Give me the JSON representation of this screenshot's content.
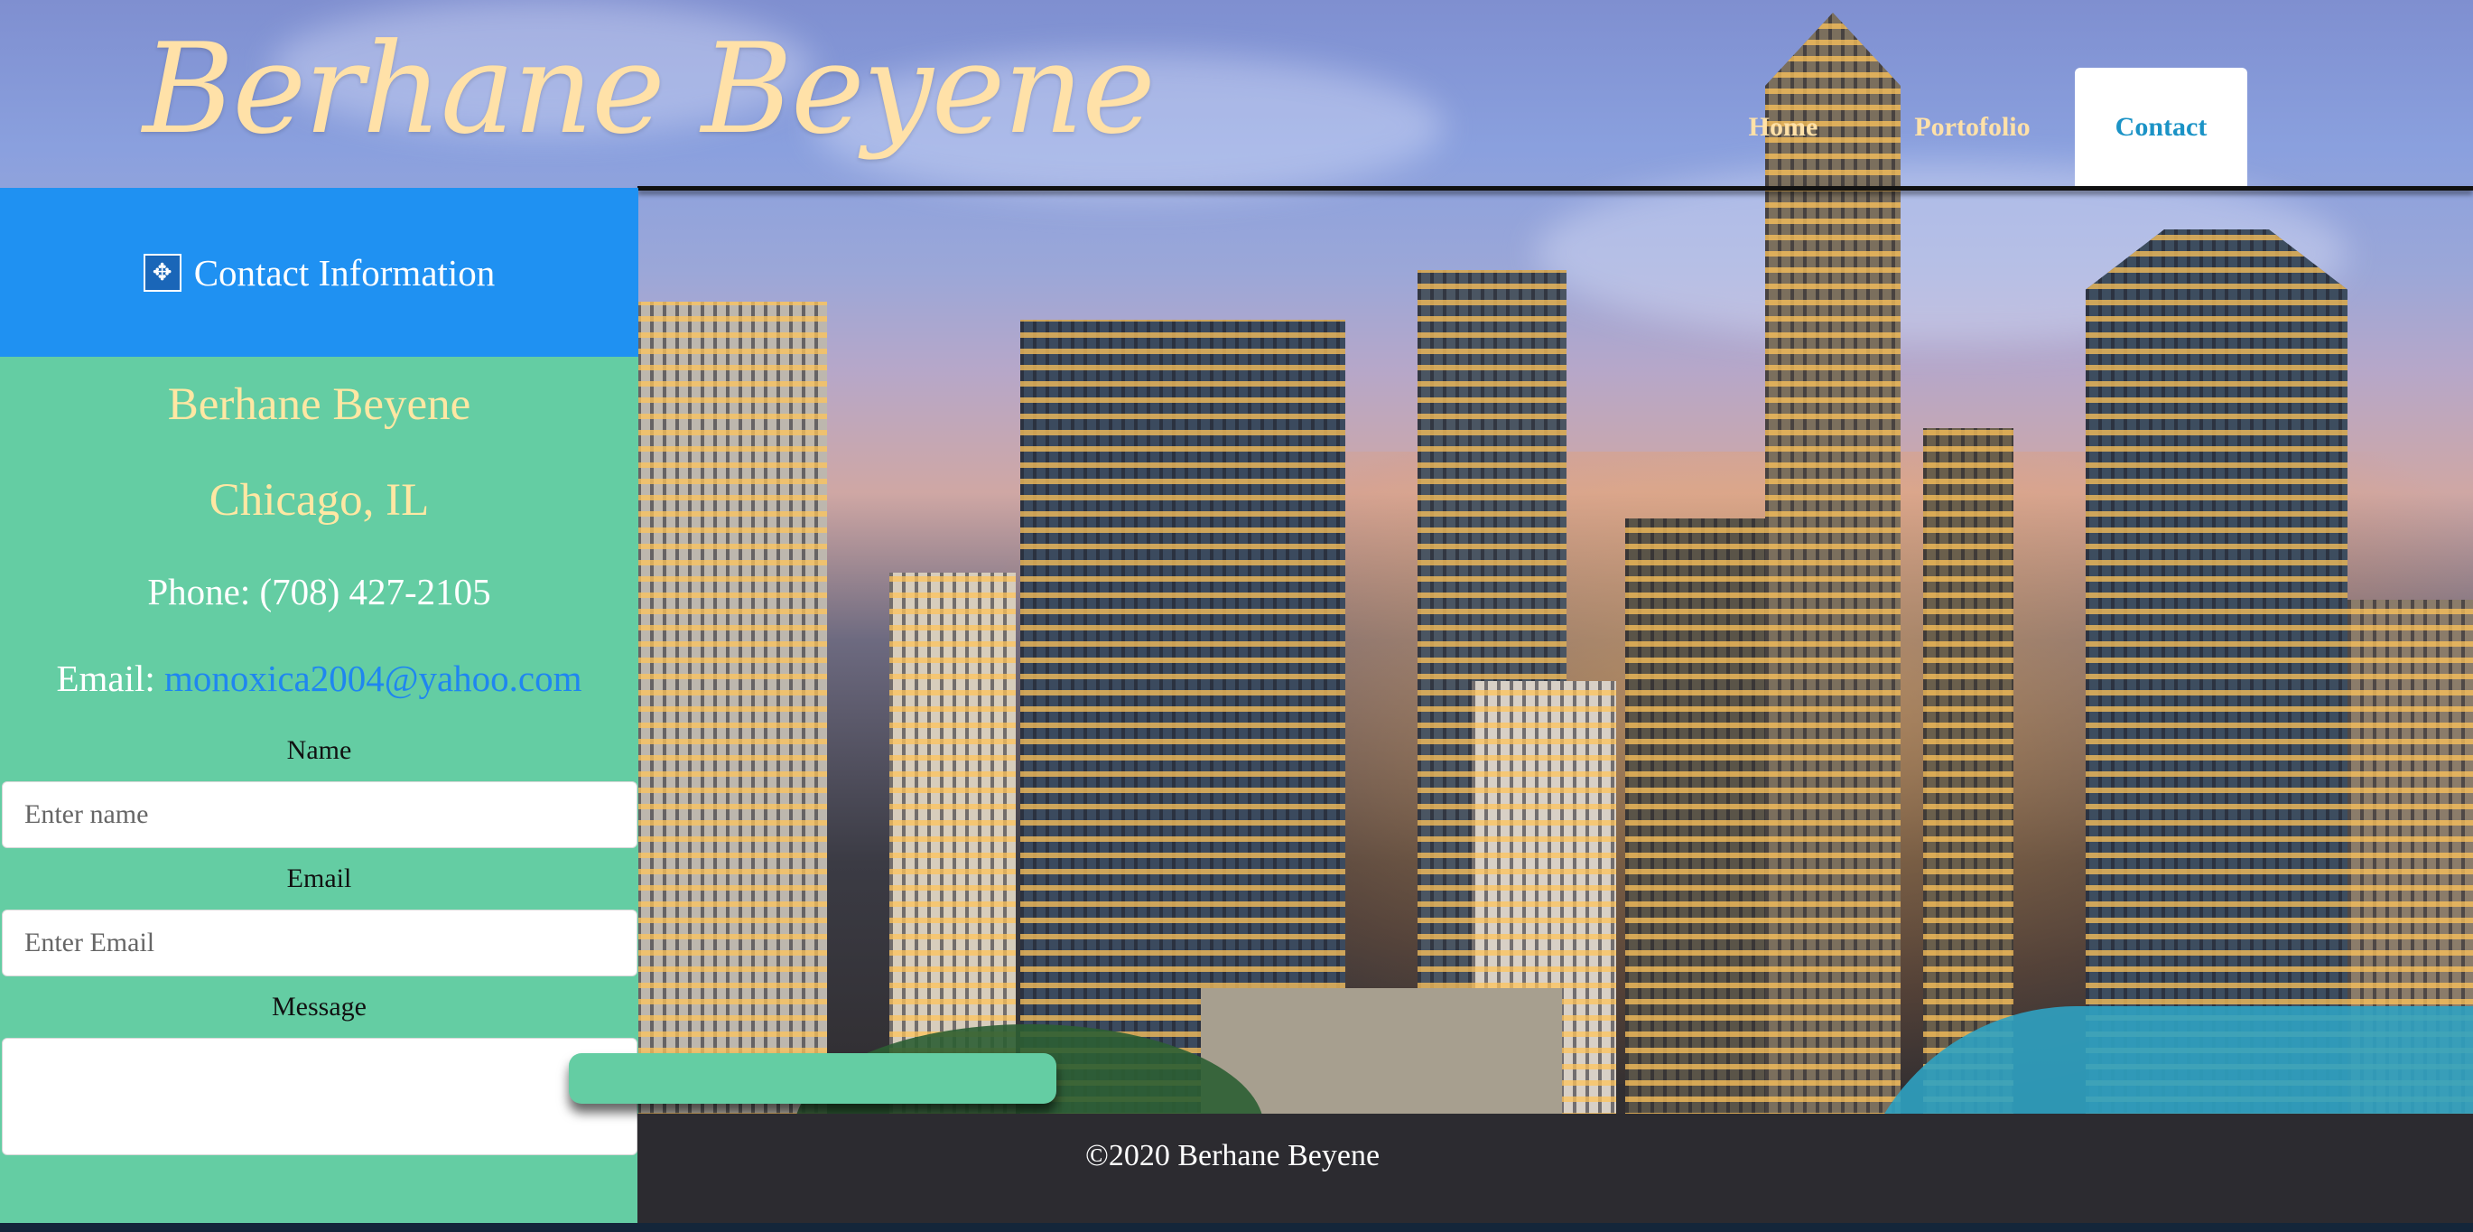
{
  "header": {
    "site_title": "Berhane Beyene",
    "nav": [
      {
        "label": "Home",
        "active": false
      },
      {
        "label": "Portofolio",
        "active": false
      },
      {
        "label": "Contact",
        "active": true
      }
    ]
  },
  "contact": {
    "heading": "Contact Information",
    "heading_icon": "move-arrows-icon",
    "name": "Berhane Beyene",
    "city": "Chicago, IL",
    "phone": "Phone: (708) 427-2105",
    "email_prefix": "Email:",
    "email": "monoxica2004@yahoo.com"
  },
  "form": {
    "name_label": "Name",
    "name_placeholder": "Enter name",
    "email_label": "Email",
    "email_placeholder": "Enter Email",
    "message_label": "Message",
    "message_placeholder": ""
  },
  "footer": {
    "copyright": "©2020 Berhane Beyene"
  },
  "colors": {
    "title": "#ffe1a8",
    "panel_head": "#1f91f2",
    "panel_body": "#64cda3",
    "link": "#1f86f0",
    "footer": "#2c2b30",
    "active_nav_text": "#1b93c6"
  }
}
